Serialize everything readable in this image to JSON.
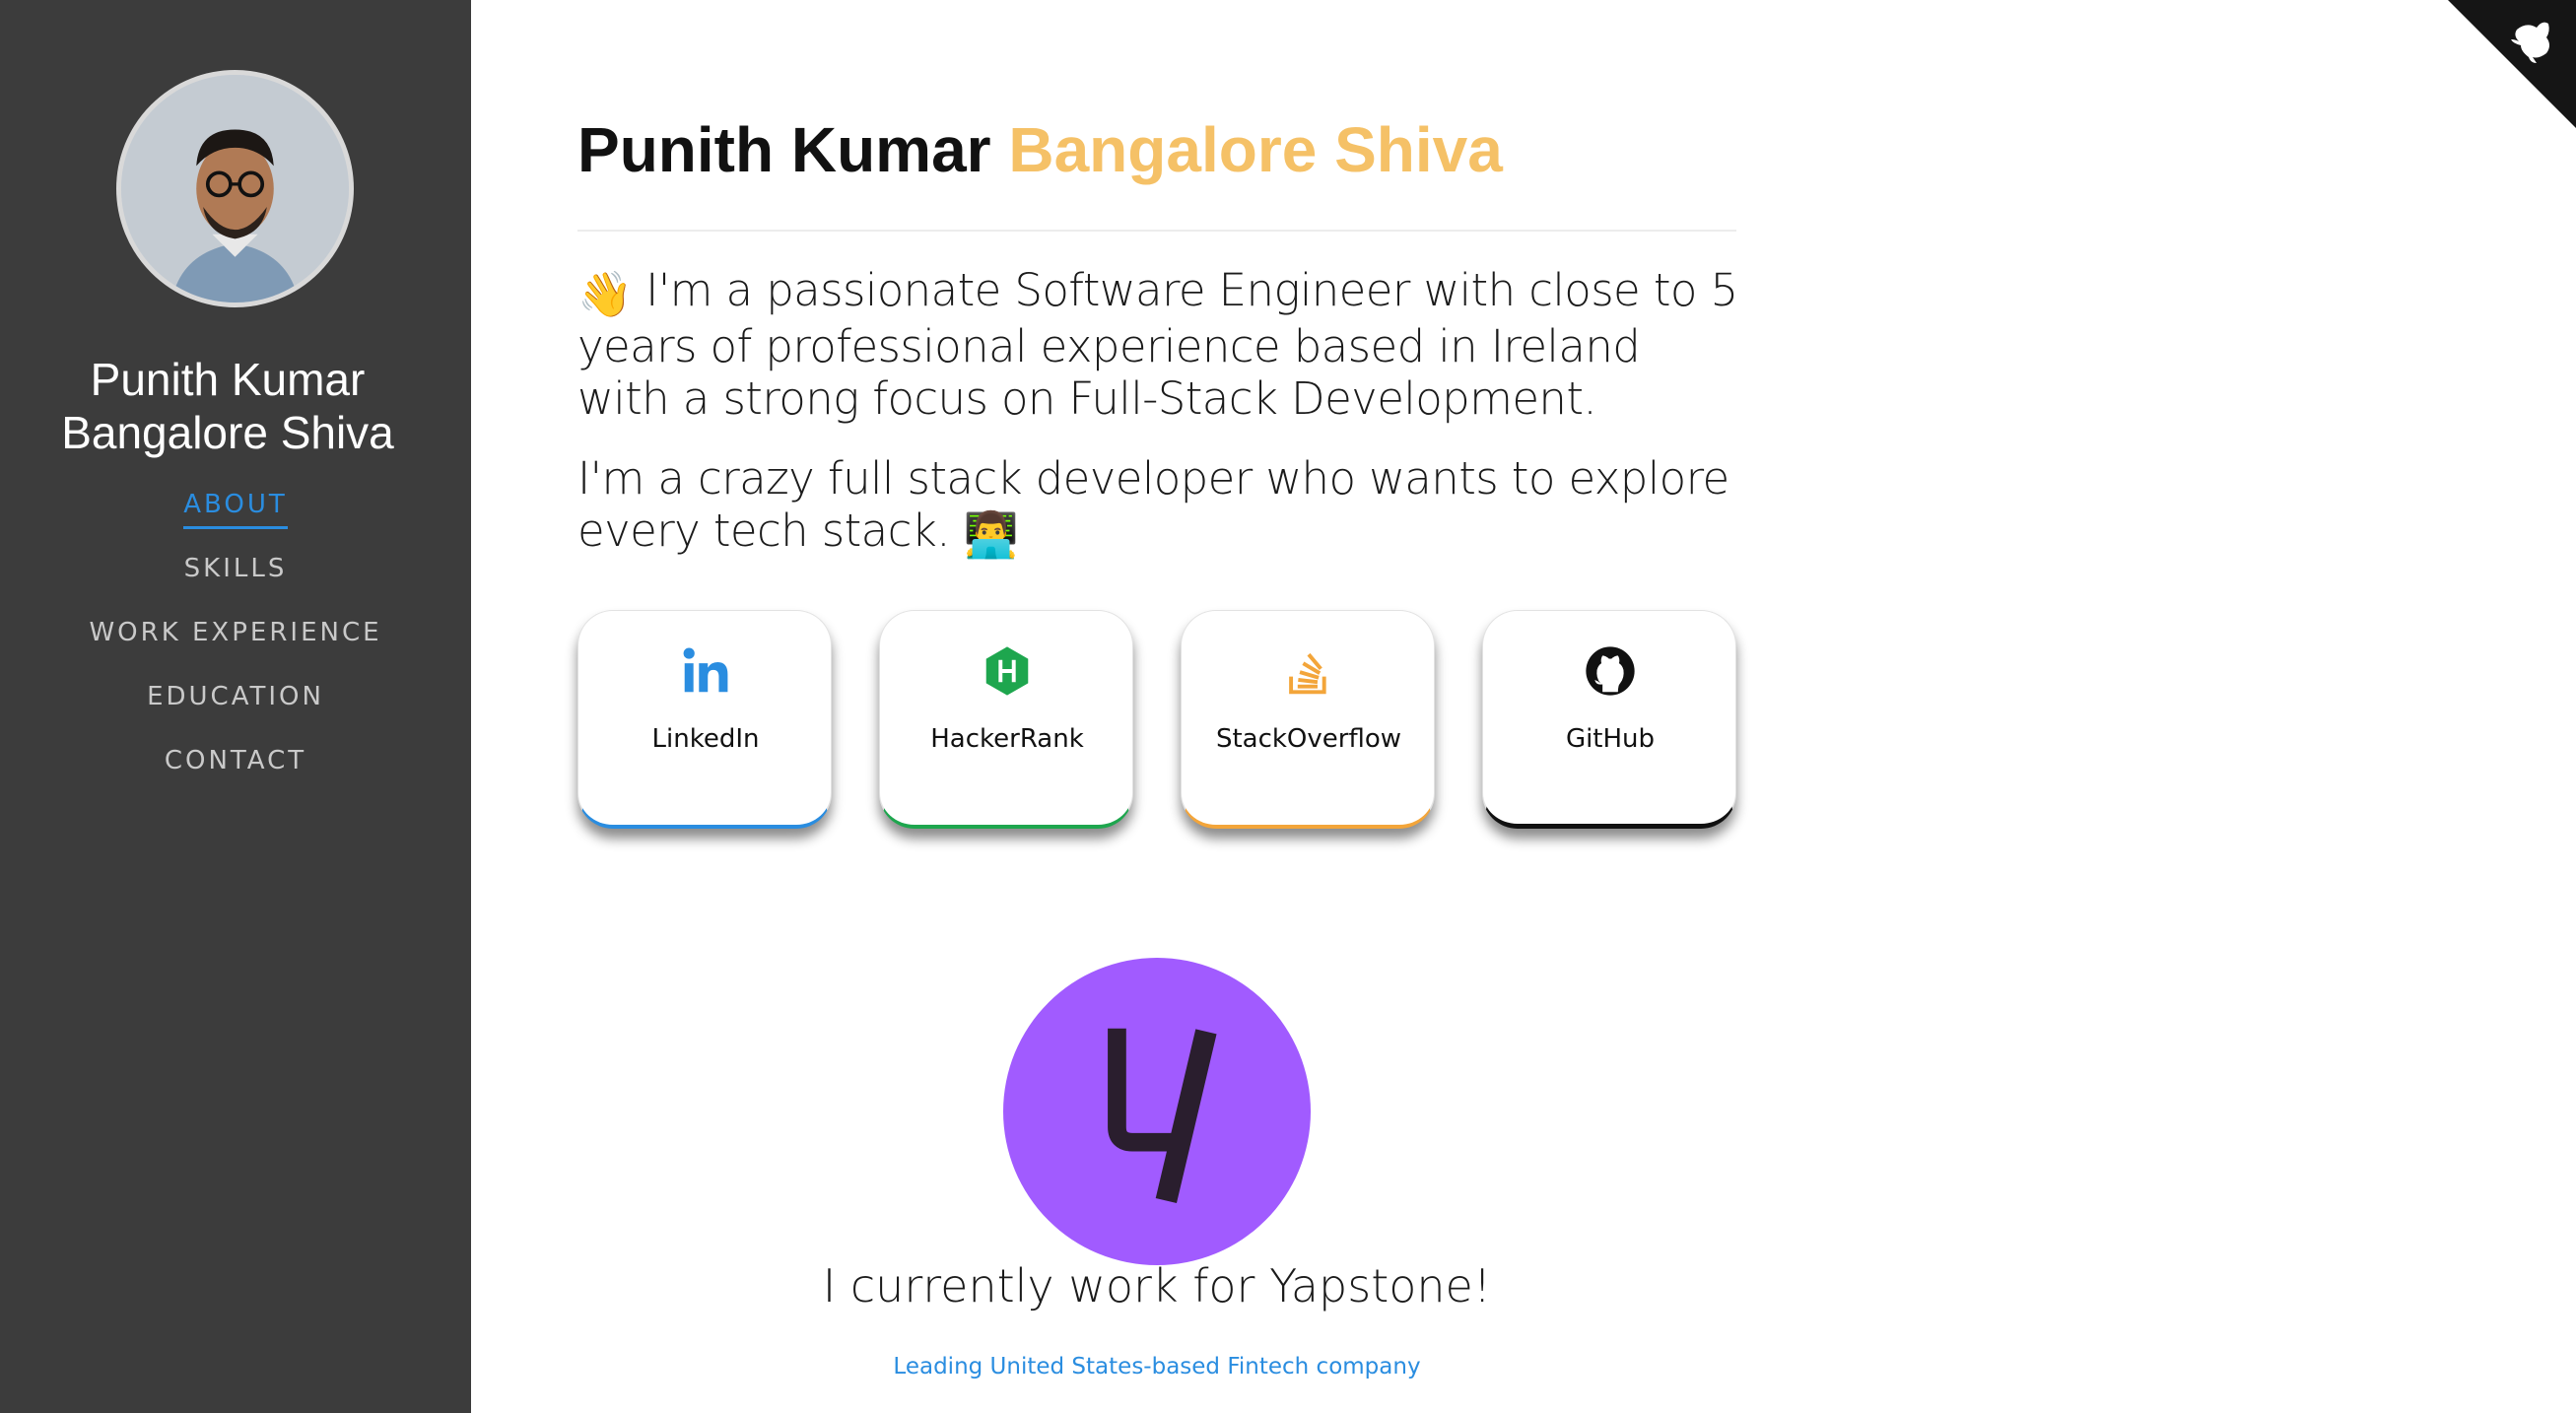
{
  "sidebar": {
    "name_line1": "Punith Kumar",
    "name_line2": "Bangalore Shiva",
    "nav": [
      "ABOUT",
      "SKILLS",
      "WORK EXPERIENCE",
      "EDUCATION",
      "CONTACT"
    ],
    "active": "ABOUT"
  },
  "main": {
    "title_first": "Punith Kumar",
    "title_accent": "Bangalore Shiva",
    "intro_emoji": "👋",
    "intro_text": "I'm a passionate Software Engineer with close to 5 years of professional experience based in Ireland with a strong focus on Full-Stack Development.",
    "second_text": "I'm a crazy full stack developer who wants to explore every tech stack.",
    "second_emoji": "👨‍💻",
    "profiles": [
      {
        "label": "LinkedIn",
        "icon": "linkedin-icon",
        "color": "#2a8de0"
      },
      {
        "label": "HackerRank",
        "icon": "hackerrank-icon",
        "color": "#1ea64e"
      },
      {
        "label": "StackOverflow",
        "icon": "stackoverflow-icon",
        "color": "#f3a53a"
      },
      {
        "label": "GitHub",
        "icon": "github-icon",
        "color": "#111111"
      }
    ],
    "company_text": "I currently work for Yapstone!",
    "company_sub": "Leading United States-based Fintech company"
  },
  "colors": {
    "sidebar_bg": "#3c3c3c",
    "accent": "#f5c167",
    "link": "#2a8de0",
    "company_logo": "#a15bff"
  }
}
